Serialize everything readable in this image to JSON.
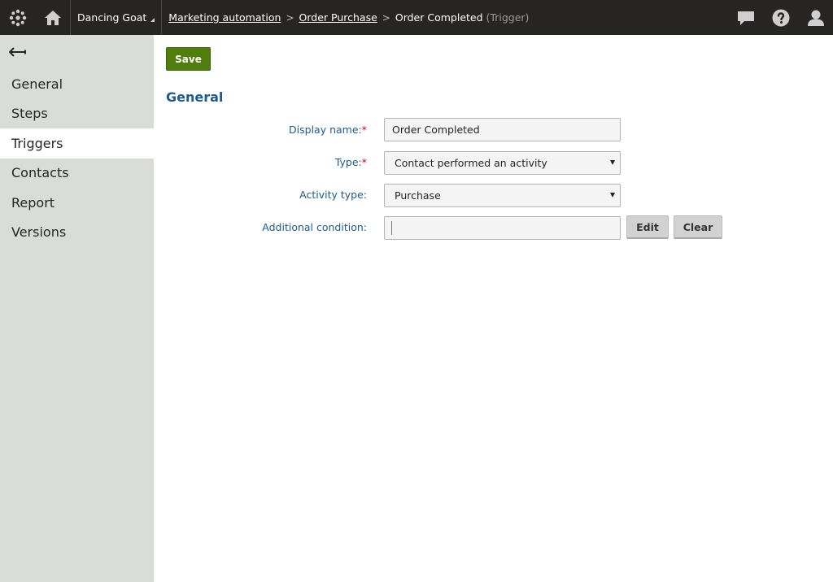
{
  "header": {
    "site_name": "Dancing Goat",
    "breadcrumbs": [
      {
        "label": "Marketing automation"
      },
      {
        "label": "Order Purchase"
      }
    ],
    "current": "Order Completed",
    "current_type": "(Trigger)",
    "breadcrumb_separator": ">"
  },
  "icons": {
    "logo": "app-logo-icon",
    "home": "home-icon",
    "chat": "chat-icon",
    "help": "help-icon",
    "user": "user-icon",
    "back": "back-arrow-icon"
  },
  "sidebar": {
    "items": [
      {
        "label": "General"
      },
      {
        "label": "Steps"
      },
      {
        "label": "Triggers",
        "active": true
      },
      {
        "label": "Contacts"
      },
      {
        "label": "Report"
      },
      {
        "label": "Versions"
      }
    ]
  },
  "toolbar": {
    "save_label": "Save"
  },
  "form": {
    "section_title": "General",
    "required_mark": "*",
    "display_name": {
      "label": "Display name:",
      "value": "Order Completed"
    },
    "type": {
      "label": "Type:",
      "value": "Contact performed an activity"
    },
    "activity_type": {
      "label": "Activity type:",
      "value": "Purchase"
    },
    "additional_condition": {
      "label": "Additional condition:",
      "value": "",
      "edit_label": "Edit",
      "clear_label": "Clear"
    }
  },
  "colors": {
    "topbar_bg": "#262524",
    "sidebar_bg": "#d9dcd9",
    "label_blue": "#1d5b8e",
    "save_green": "#4f7d0e",
    "required_red": "#d0021b"
  }
}
